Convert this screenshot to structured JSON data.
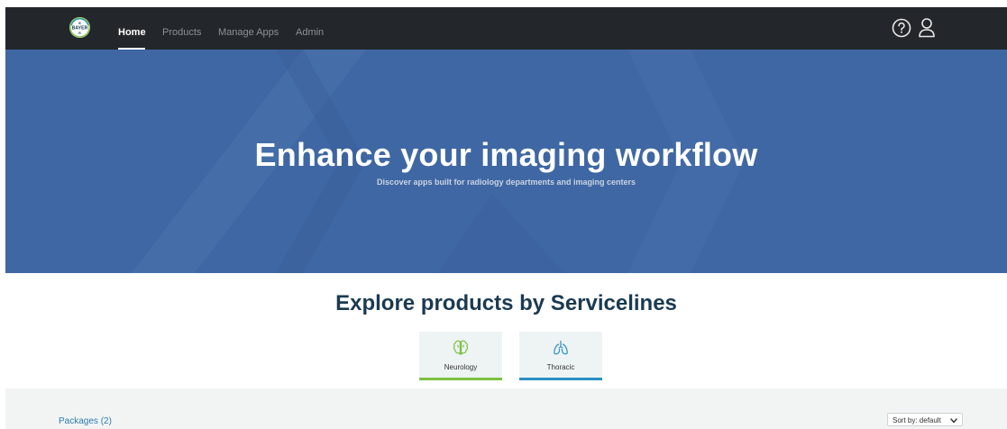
{
  "brand": {
    "logo_text": "BAYER"
  },
  "nav": {
    "items": [
      {
        "label": "Home",
        "active": true
      },
      {
        "label": "Products",
        "active": false
      },
      {
        "label": "Manage Apps",
        "active": false
      },
      {
        "label": "Admin",
        "active": false
      }
    ],
    "icons": [
      "help-icon",
      "user-icon"
    ]
  },
  "hero": {
    "title": "Enhance your imaging workflow",
    "subtitle": "Discover apps built for radiology departments and imaging centers",
    "background_color": "#3f67a3"
  },
  "servicelines": {
    "title": "Explore products by Servicelines",
    "cards": [
      {
        "label": "Neurology",
        "icon": "brain-icon",
        "accent": "#7cc142"
      },
      {
        "label": "Thoracic",
        "icon": "lungs-icon",
        "accent": "#2a8fc4"
      }
    ]
  },
  "packages": {
    "label": "Packages (2)",
    "sort_label": "Sort by: default"
  }
}
